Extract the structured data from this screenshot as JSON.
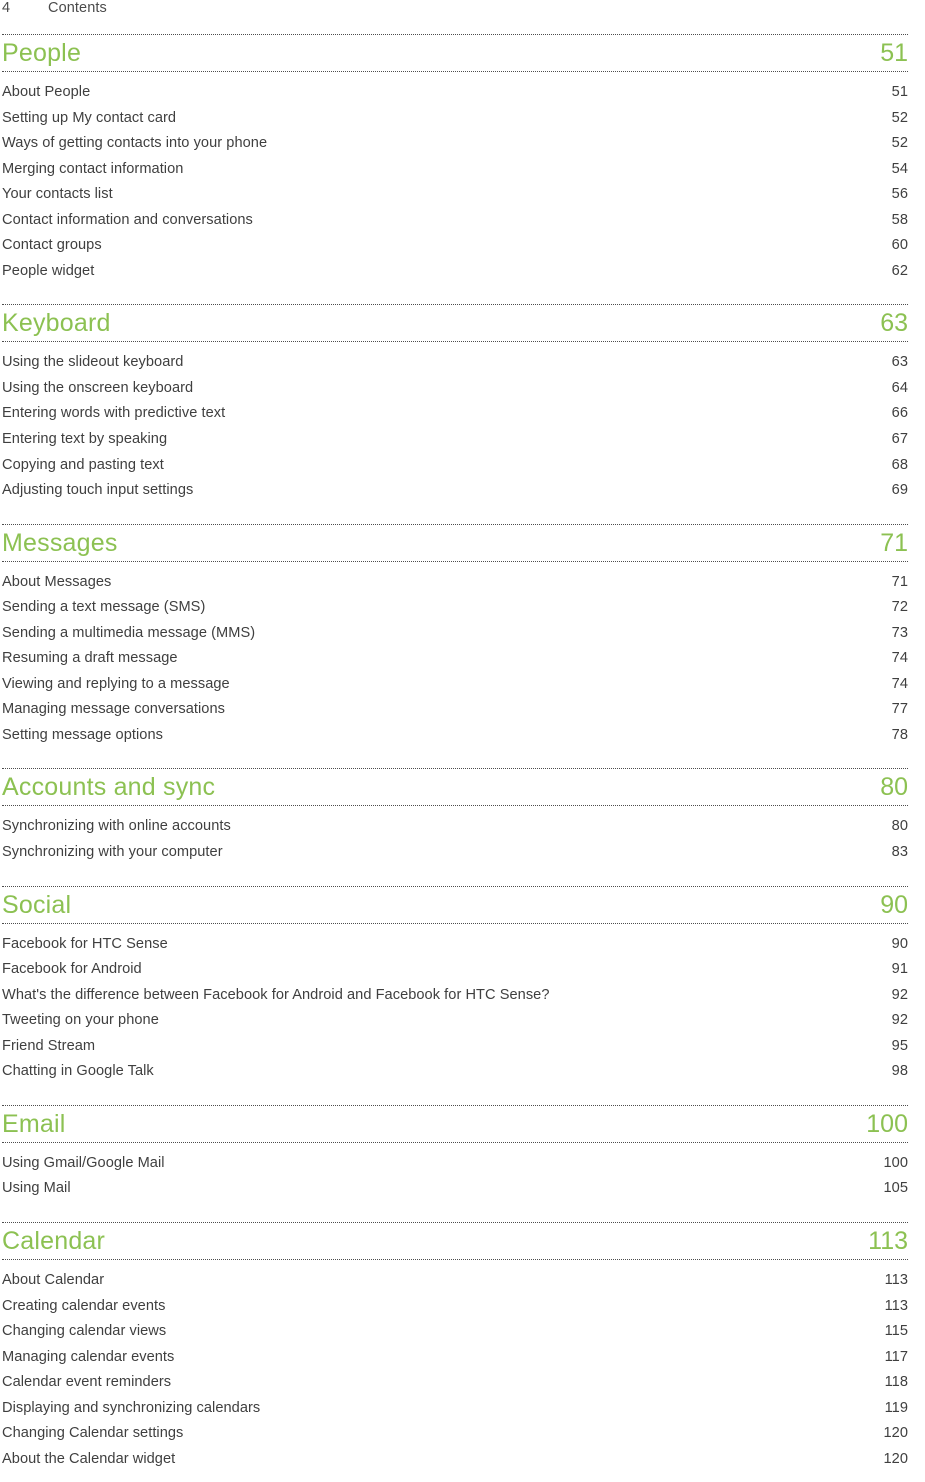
{
  "header": {
    "folio": "4",
    "title": "Contents"
  },
  "theme": {
    "accent_green": "#8cc152",
    "body_text": "#3f3f3f",
    "rule_color": "#4d4d4d"
  },
  "toc": {
    "sections": [
      {
        "title": "People",
        "page": "51",
        "entries": [
          {
            "title": "About People",
            "page": "51"
          },
          {
            "title": "Setting up My contact card",
            "page": "52"
          },
          {
            "title": "Ways of getting contacts into your phone",
            "page": "52"
          },
          {
            "title": "Merging contact information",
            "page": "54"
          },
          {
            "title": "Your contacts list",
            "page": "56"
          },
          {
            "title": "Contact information and conversations",
            "page": "58"
          },
          {
            "title": "Contact groups",
            "page": "60"
          },
          {
            "title": "People widget",
            "page": "62"
          }
        ]
      },
      {
        "title": "Keyboard",
        "page": "63",
        "entries": [
          {
            "title": "Using the slideout keyboard",
            "page": "63"
          },
          {
            "title": "Using the onscreen keyboard",
            "page": "64"
          },
          {
            "title": "Entering words with predictive text",
            "page": "66"
          },
          {
            "title": "Entering text by speaking",
            "page": "67"
          },
          {
            "title": "Copying and pasting text",
            "page": "68"
          },
          {
            "title": "Adjusting touch input settings",
            "page": "69"
          }
        ]
      },
      {
        "title": "Messages",
        "page": "71",
        "entries": [
          {
            "title": "About Messages",
            "page": "71"
          },
          {
            "title": "Sending a text message (SMS)",
            "page": "72"
          },
          {
            "title": "Sending a multimedia message (MMS)",
            "page": "73"
          },
          {
            "title": "Resuming a draft message",
            "page": "74"
          },
          {
            "title": "Viewing and replying to a message",
            "page": "74"
          },
          {
            "title": "Managing message conversations",
            "page": "77"
          },
          {
            "title": "Setting message options",
            "page": "78"
          }
        ]
      },
      {
        "title": "Accounts and sync",
        "page": "80",
        "entries": [
          {
            "title": "Synchronizing with online accounts",
            "page": "80"
          },
          {
            "title": "Synchronizing with your computer",
            "page": "83"
          }
        ]
      },
      {
        "title": "Social",
        "page": "90",
        "entries": [
          {
            "title": "Facebook for HTC Sense",
            "page": "90"
          },
          {
            "title": "Facebook for Android",
            "page": "91"
          },
          {
            "title": "What's the difference between Facebook for Android and Facebook for HTC Sense?",
            "page": "92"
          },
          {
            "title": "Tweeting on your phone",
            "page": "92"
          },
          {
            "title": "Friend Stream",
            "page": "95"
          },
          {
            "title": "Chatting in Google Talk",
            "page": "98"
          }
        ]
      },
      {
        "title": "Email",
        "page": "100",
        "entries": [
          {
            "title": "Using Gmail/Google Mail",
            "page": "100"
          },
          {
            "title": "Using Mail",
            "page": "105"
          }
        ]
      },
      {
        "title": "Calendar",
        "page": "113",
        "entries": [
          {
            "title": "About Calendar",
            "page": "113"
          },
          {
            "title": "Creating calendar events",
            "page": "113"
          },
          {
            "title": "Changing calendar views",
            "page": "115"
          },
          {
            "title": "Managing calendar events",
            "page": "117"
          },
          {
            "title": "Calendar event reminders",
            "page": "118"
          },
          {
            "title": "Displaying and synchronizing calendars",
            "page": "119"
          },
          {
            "title": "Changing Calendar settings",
            "page": "120"
          },
          {
            "title": "About the Calendar widget",
            "page": "120"
          }
        ]
      }
    ]
  }
}
